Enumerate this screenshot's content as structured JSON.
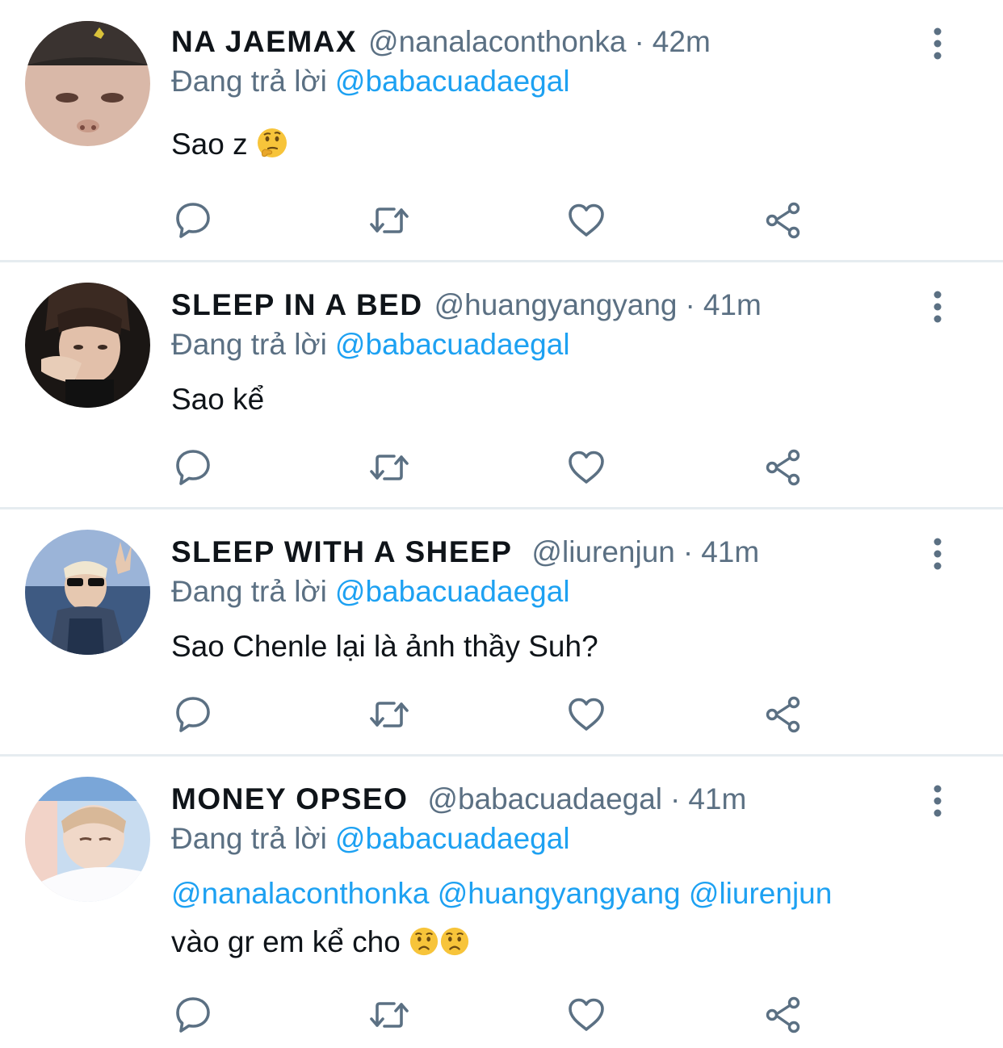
{
  "reply_prefix": "Đang trả lời",
  "colors": {
    "link": "#1da1f2",
    "muted": "#5b7083",
    "text": "#0f1419",
    "divider": "#e6ecf0"
  },
  "tweets": [
    {
      "name": "NA JAEMAX",
      "handle": "@nanalaconthonka",
      "separator": "·",
      "time": "42m",
      "replying_to": "@babacuadaegal",
      "text": "Sao z",
      "emoji": [
        "thinking-face"
      ]
    },
    {
      "name": "SLEEP IN A BED",
      "handle": "@huangyangyang",
      "separator": "·",
      "time": "41m",
      "replying_to": "@babacuadaegal",
      "text": "Sao kể",
      "emoji": []
    },
    {
      "name": "SLEEP WITH A SHEEP",
      "handle": "@liurenjun",
      "separator": "·",
      "time": "41m",
      "replying_to": "@babacuadaegal",
      "text": "Sao Chenle lại là ảnh thầy Suh?",
      "emoji": []
    },
    {
      "name": "MONEY OPSEO",
      "handle": "@babacuadaegal",
      "separator": "·",
      "time": "41m",
      "replying_to": "@babacuadaegal",
      "mentions": [
        "@nanalaconthonka",
        "@huangyangyang",
        "@liurenjun"
      ],
      "text": "vào gr em kể cho",
      "emoji": [
        "worried-face",
        "worried-face"
      ]
    }
  ],
  "action_icons": [
    "reply-icon",
    "retweet-icon",
    "like-icon",
    "share-icon"
  ],
  "more_icon": "more-vertical-icon"
}
